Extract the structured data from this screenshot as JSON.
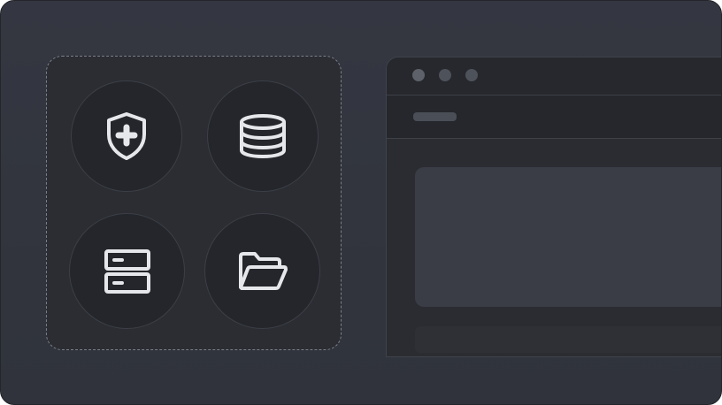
{
  "tiles": [
    {
      "icon": "shield-plus-icon",
      "label": ""
    },
    {
      "icon": "database-icon",
      "label": ""
    },
    {
      "icon": "server-icon",
      "label": ""
    },
    {
      "icon": "folder-open-icon",
      "label": ""
    }
  ],
  "window": {
    "controls": [
      "close-dot",
      "minimize-dot",
      "maximize-dot"
    ],
    "toolbar_label": ""
  },
  "colors": {
    "background": "#343741",
    "tile": "#24262b",
    "icon": "#e4e5e9",
    "panel": "#3a3d45"
  }
}
